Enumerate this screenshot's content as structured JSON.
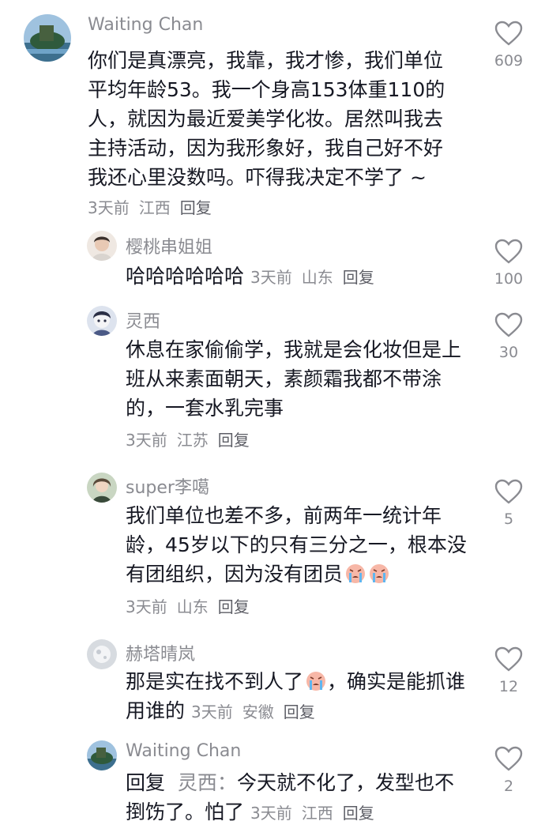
{
  "comments": [
    {
      "username": "Waiting Chan",
      "text": "你们是真漂亮，我靠，我才惨，我们单位平均年龄53。我一个身高153体重110的人，就因为最近爱美学化妆。居然叫我去主持活动，因为我形象好，我自己好不好我还心里没数吗。吓得我决定不学了 ~",
      "time": "3天前",
      "location": "江西",
      "reply_label": "回复",
      "likes": "609",
      "avatar_icon": "landscape-avatar"
    },
    {
      "username": "樱桃串姐姐",
      "text": "哈哈哈哈哈哈",
      "time": "3天前",
      "location": "山东",
      "reply_label": "回复",
      "likes": "100",
      "avatar_icon": "portrait-avatar"
    },
    {
      "username": "灵西",
      "text": "休息在家偷偷学，我就是会化妆但是上班从来素面朝天，素颜霜我都不带涂的，一套水乳完事",
      "time": "3天前",
      "location": "江苏",
      "reply_label": "回复",
      "likes": "30",
      "avatar_icon": "cartoon-avatar"
    },
    {
      "username": "super李噶",
      "text": "我们单位也差不多，前两年一统计年龄，45岁以下的只有三分之一，根本没有团组织，因为没有团员",
      "emoji": "crying-face-emoji x2",
      "time": "3天前",
      "location": "山东",
      "reply_label": "回复",
      "likes": "5",
      "avatar_icon": "portrait-avatar"
    },
    {
      "username": "赫塔晴岚",
      "text_before_emoji": "那是实在找不到人了",
      "emoji": "crying-face-emoji",
      "text_after_emoji": "，确实是能抓谁用谁的",
      "time": "3天前",
      "location": "安徽",
      "reply_label": "回复",
      "likes": "12",
      "avatar_icon": "moon-avatar"
    },
    {
      "username": "Waiting Chan",
      "reply_prefix": "回复",
      "reply_to": "灵西：",
      "text": "今天就不化了，发型也不捯饬了。怕了",
      "time": "3天前",
      "location": "江西",
      "reply_label": "回复",
      "likes": "2",
      "avatar_icon": "landscape-avatar"
    }
  ],
  "colors": {
    "text": "#161823",
    "secondary": "#8a8b91",
    "heart_stroke": "#8a8b91"
  }
}
